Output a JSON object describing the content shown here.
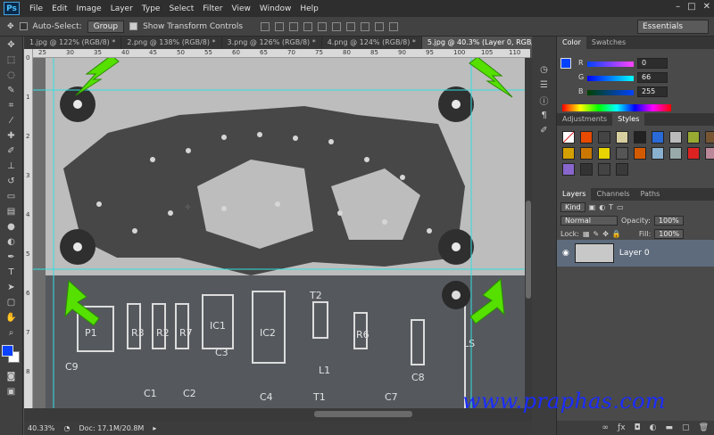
{
  "app": {
    "logo": "Ps"
  },
  "menu": [
    "File",
    "Edit",
    "Image",
    "Layer",
    "Type",
    "Select",
    "Filter",
    "View",
    "Window",
    "Help"
  ],
  "window_buttons": [
    "–",
    "□",
    "✕"
  ],
  "options": {
    "auto_select_label": "Auto-Select:",
    "auto_select_value": "Group",
    "transform_label": "Show Transform Controls",
    "workspace": "Essentials"
  },
  "tabs": [
    {
      "label": "1.jpg @ 122% (RGB/8) *",
      "active": false
    },
    {
      "label": "2.png @ 138% (RGB/8) *",
      "active": false
    },
    {
      "label": "3.png @ 126% (RGB/8) *",
      "active": false
    },
    {
      "label": "4.png @ 124% (RGB/8) *",
      "active": false
    },
    {
      "label": "5.jpg @ 40.3% (Layer 0, RGB/8) *",
      "active": true
    }
  ],
  "ruler_top": [
    "25",
    "30",
    "35",
    "40",
    "45",
    "50",
    "55",
    "60",
    "65",
    "70",
    "75",
    "80",
    "85",
    "90",
    "95",
    "100",
    "105",
    "110"
  ],
  "ruler_left": [
    "0",
    "1",
    "2",
    "3",
    "4",
    "5",
    "6",
    "7",
    "8",
    "9"
  ],
  "status": {
    "zoom": "40.33%",
    "doc": "Doc: 17.1M/20.8M"
  },
  "color_panel": {
    "tabs": [
      "Color",
      "Swatches"
    ],
    "channels": [
      {
        "label": "R",
        "value": "0"
      },
      {
        "label": "G",
        "value": "66"
      },
      {
        "label": "B",
        "value": "255"
      }
    ],
    "fg_color": "#0042ff"
  },
  "styles_panel": {
    "tabs": [
      "Adjustments",
      "Styles"
    ]
  },
  "layers_panel": {
    "tabs": [
      "Layers",
      "Channels",
      "Paths"
    ],
    "kind": "Kind",
    "blend_mode": "Normal",
    "opacity_label": "Opacity:",
    "opacity": "100%",
    "lock_label": "Lock:",
    "fill_label": "Fill:",
    "fill": "100%",
    "layer_name": "Layer 0"
  },
  "pcb_labels": [
    "P1",
    "C9",
    "R3",
    "R2",
    "R7",
    "IC1",
    "IC2",
    "C3",
    "T2",
    "R6",
    "C4",
    "T1",
    "L1",
    "C1",
    "C2",
    "C8",
    "C7",
    "LS"
  ],
  "watermark": "www.praphas.com"
}
